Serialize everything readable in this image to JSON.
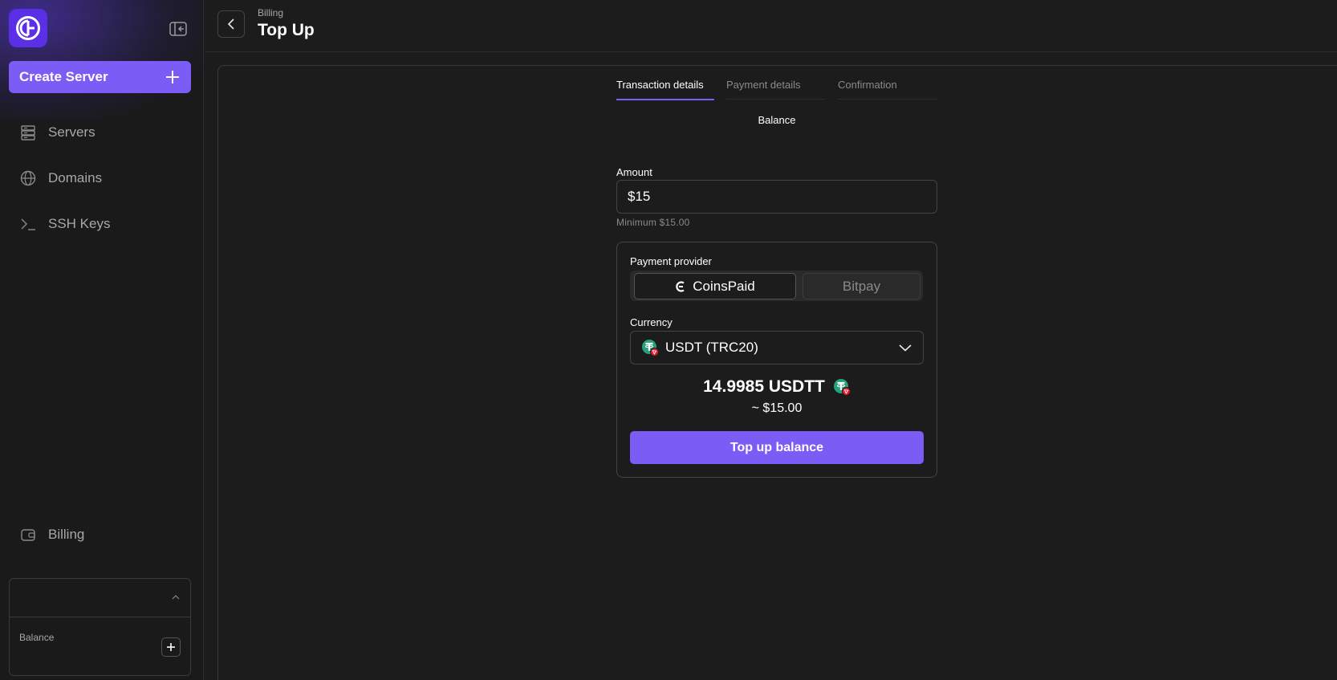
{
  "sidebar": {
    "create_button": "Create Server",
    "items": [
      {
        "label": "Servers",
        "icon": "server-icon"
      },
      {
        "label": "Domains",
        "icon": "globe-icon"
      },
      {
        "label": "SSH Keys",
        "icon": "terminal-icon"
      }
    ],
    "billing": {
      "label": "Billing",
      "icon": "wallet-icon"
    },
    "account": {
      "balance_label": "Balance"
    }
  },
  "header": {
    "breadcrumb": "Billing",
    "title": "Top Up"
  },
  "steps": [
    {
      "label": "Transaction details",
      "active": true
    },
    {
      "label": "Payment details",
      "active": false
    },
    {
      "label": "Confirmation",
      "active": false
    }
  ],
  "form": {
    "subtitle": "Balance",
    "amount_label": "Amount",
    "amount_value": "$15",
    "minimum_text": "Minimum $15.00",
    "provider_label": "Payment provider",
    "providers": [
      {
        "label": "CoinsPaid",
        "selected": true
      },
      {
        "label": "Bitpay",
        "selected": false
      }
    ],
    "currency_label": "Currency",
    "currency_value": "USDT (TRC20)",
    "crypto_amount": "14.9985 USDTT",
    "usd_approx": "~ $15.00",
    "submit_label": "Top up balance"
  },
  "colors": {
    "accent": "#7b5cf5",
    "logo": "#5a2fe6",
    "background": "#1c1c1c",
    "tether": "#26a17b",
    "tron": "#e5192b"
  }
}
